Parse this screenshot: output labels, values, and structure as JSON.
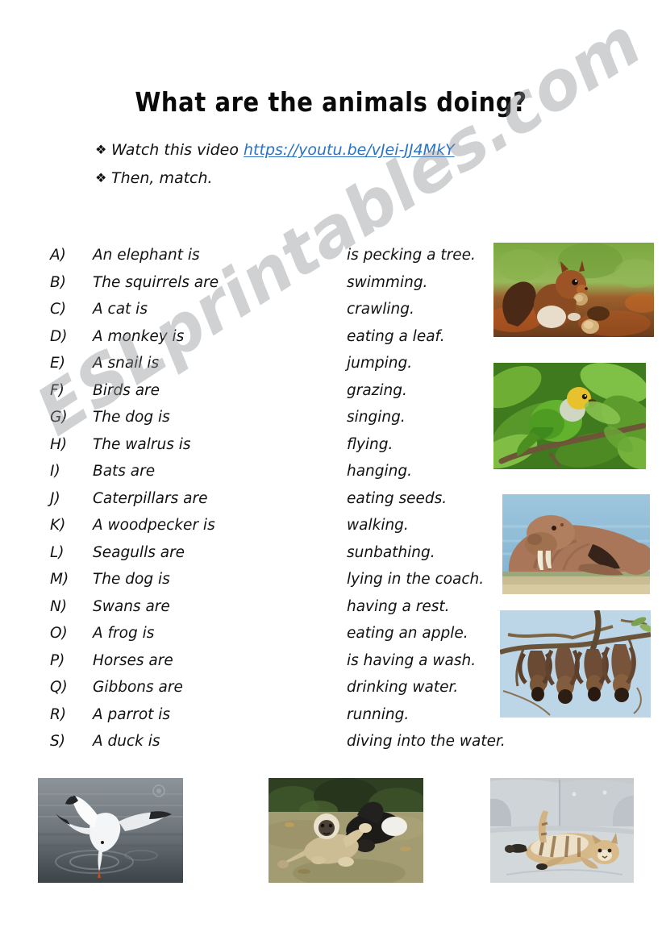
{
  "page": {
    "title": "What are the animals doing?",
    "watermark": "ESLprintables.com"
  },
  "instructions": [
    {
      "bullet": "diamond-bullet",
      "text": "Watch this video ",
      "link": "https://youtu.be/vJei-JJ4MkY"
    },
    {
      "bullet": "diamond-bullet",
      "text": "Then, match.",
      "link": ""
    }
  ],
  "match_exercise": {
    "left_column": [
      {
        "label": "A)",
        "phrase": "An elephant is"
      },
      {
        "label": "B)",
        "phrase": "The squirrels are"
      },
      {
        "label": "C)",
        "phrase": "A cat is"
      },
      {
        "label": "D)",
        "phrase": "A monkey is"
      },
      {
        "label": "E)",
        "phrase": "A snail is"
      },
      {
        "label": "F)",
        "phrase": "Birds are"
      },
      {
        "label": "G)",
        "phrase": "The dog is"
      },
      {
        "label": "H)",
        "phrase": "The walrus is"
      },
      {
        "label": "I)",
        "phrase": "Bats are"
      },
      {
        "label": "J)",
        "phrase": "Caterpillars are"
      },
      {
        "label": "K)",
        "phrase": "A woodpecker is"
      },
      {
        "label": "L)",
        "phrase": "Seagulls are"
      },
      {
        "label": "M)",
        "phrase": "The dog is"
      },
      {
        "label": "N)",
        "phrase": "Swans are"
      },
      {
        "label": "O)",
        "phrase": "A frog is"
      },
      {
        "label": "P)",
        "phrase": "Horses are"
      },
      {
        "label": "Q)",
        "phrase": "Gibbons are"
      },
      {
        "label": "R)",
        "phrase": "A parrot is"
      },
      {
        "label": "S)",
        "phrase": "A duck is"
      }
    ],
    "right_column": [
      {
        "phrase": "is pecking a tree."
      },
      {
        "phrase": "swimming."
      },
      {
        "phrase": "crawling."
      },
      {
        "phrase": "eating a leaf."
      },
      {
        "phrase": "jumping."
      },
      {
        "phrase": "grazing."
      },
      {
        "phrase": "singing."
      },
      {
        "phrase": "flying."
      },
      {
        "phrase": "hanging."
      },
      {
        "phrase": "eating seeds."
      },
      {
        "phrase": "walking."
      },
      {
        "phrase": "sunbathing."
      },
      {
        "phrase": "lying in the coach."
      },
      {
        "phrase": "having a rest."
      },
      {
        "phrase": "eating an apple."
      },
      {
        "phrase": "is having a wash."
      },
      {
        "phrase": "drinking water."
      },
      {
        "phrase": "running."
      },
      {
        "phrase": "diving into the water."
      }
    ]
  },
  "photos": [
    {
      "name": "squirrel-photo",
      "caption": "squirrel eating a nut on forest floor"
    },
    {
      "name": "parrot-photo",
      "caption": "green parrot perched on a leafy branch"
    },
    {
      "name": "walrus-photo",
      "caption": "walrus lying on a beach by the sea"
    },
    {
      "name": "bats-photo",
      "caption": "bats hanging upside down from branches"
    },
    {
      "name": "seagull-photo",
      "caption": "seagull diving into the water"
    },
    {
      "name": "gibbons-photo",
      "caption": "gibbons having a rest on the ground"
    },
    {
      "name": "cat-photo",
      "caption": "cat lying on a grey sofa"
    }
  ],
  "colors": {
    "link": "#2a72c4",
    "text": "#111111",
    "watermark": "#8c9196",
    "page_background": "#ffffff"
  }
}
